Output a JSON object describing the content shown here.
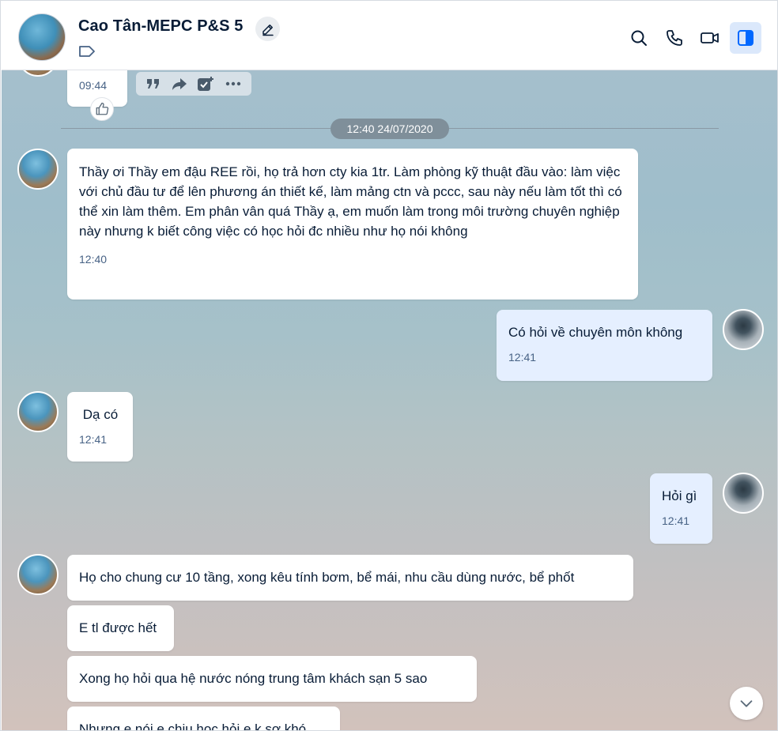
{
  "header": {
    "title": "Cao Tân-MEPC P&S 5",
    "icons": [
      "search-icon",
      "phone-icon",
      "video-call-icon",
      "sidebar-toggle-icon"
    ]
  },
  "colors": {
    "accent": "#0068ff",
    "my_bubble": "#e5efff",
    "other_bubble": "#ffffff",
    "date_pill": "#7f8f9a"
  },
  "chat": {
    "top_partial_message": {
      "time": "09:44"
    },
    "date_divider": "12:40 24/07/2020",
    "messages": [
      {
        "sender": "other",
        "text": "Thầy ơi Thầy em đậu REE rồi, họ trả hơn cty kia 1tr. Làm phòng kỹ thuật đầu vào: làm việc với chủ đầu tư để lên phương án thiết kế, làm mảng ctn và pccc, sau này nếu làm tốt thì có thể xin làm thêm. Em phân vân quá Thầy ạ, em muốn làm trong môi trường chuyên nghiệp này nhưng k biết công việc có học hỏi đc nhiều như họ nói không",
        "time": "12:40"
      },
      {
        "sender": "me",
        "text": "Có hỏi về chuyên môn không",
        "time": "12:41"
      },
      {
        "sender": "other",
        "text": " Dạ có",
        "time": "12:41"
      },
      {
        "sender": "me",
        "text": "Hỏi gì",
        "time": "12:41"
      },
      {
        "sender": "other",
        "text": "Họ cho chung cư 10 tầng, xong kêu tính bơm, bể mái, nhu cầu dùng nước, bể phốt"
      },
      {
        "sender": "other",
        "text": "E tl được hết"
      },
      {
        "sender": "other",
        "text": "Xong họ hỏi qua hệ nước nóng trung tâm khách sạn 5 sao"
      },
      {
        "sender": "other",
        "text": "Nhưng e nói e chịu học hỏi e k sợ khó"
      }
    ]
  }
}
